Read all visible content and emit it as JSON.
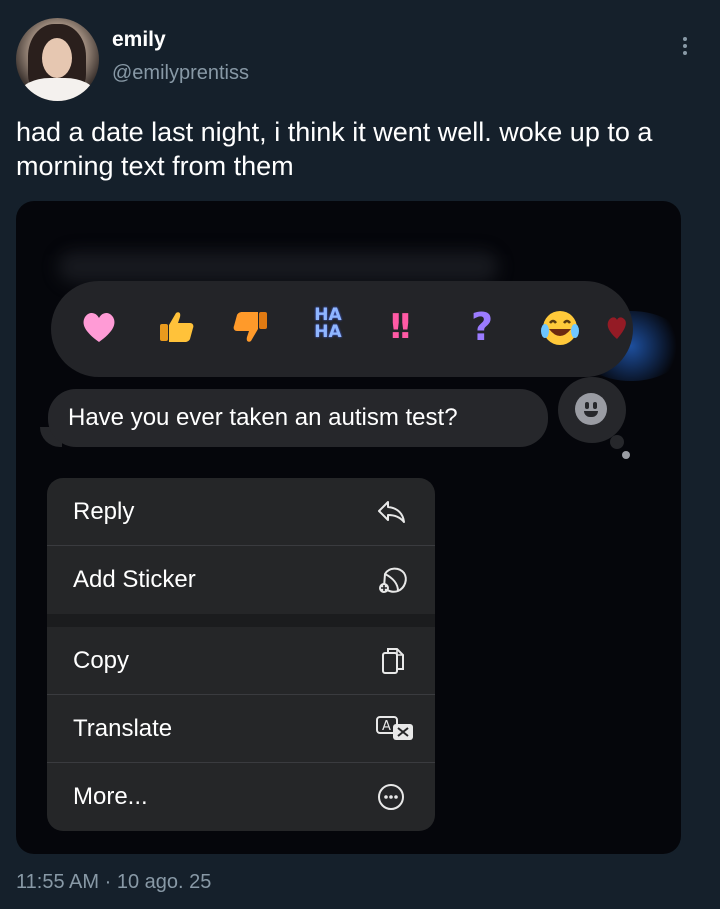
{
  "author": {
    "name": "emily",
    "handle": "@emilyprentiss"
  },
  "tweet": {
    "text": "had a date last night, i think it went well. woke up to a morning text from them"
  },
  "screenshot": {
    "reactions": [
      "heart-icon",
      "thumbs-up-icon",
      "thumbs-down-icon",
      "haha-icon",
      "exclamation-icon",
      "question-icon",
      "laugh-cry-icon",
      "red-heart-icon"
    ],
    "haha_label": "HA HA",
    "message": "Have you ever taken an autism test?",
    "menu": [
      {
        "label": "Reply",
        "icon": "reply-icon"
      },
      {
        "label": "Add Sticker",
        "icon": "add-sticker-icon"
      },
      {
        "label": "Copy",
        "icon": "copy-icon"
      },
      {
        "label": "Translate",
        "icon": "translate-icon"
      },
      {
        "label": "More...",
        "icon": "more-circle-icon"
      }
    ]
  },
  "meta": {
    "time": "11:55 AM",
    "separator": "·",
    "date": "10 ago. 25"
  },
  "colors": {
    "background": "#15202b",
    "secondary_text": "#8899a6",
    "bubble": "#26272b",
    "menu": "#252628"
  }
}
